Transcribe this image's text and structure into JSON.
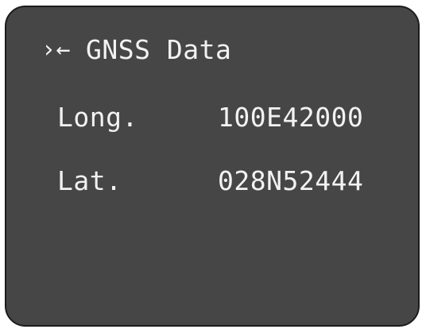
{
  "header": {
    "back_icon": "›←",
    "back_icon_name": "back-arrow-icon",
    "title": "GNSS Data"
  },
  "rows": [
    {
      "label": "Long.",
      "value": "100E42000"
    },
    {
      "label": "Lat.",
      "value": "028N52444"
    }
  ],
  "colors": {
    "screen_background": "#464646",
    "text": "#f2f2f2",
    "bezel": "#1c1c1c"
  }
}
